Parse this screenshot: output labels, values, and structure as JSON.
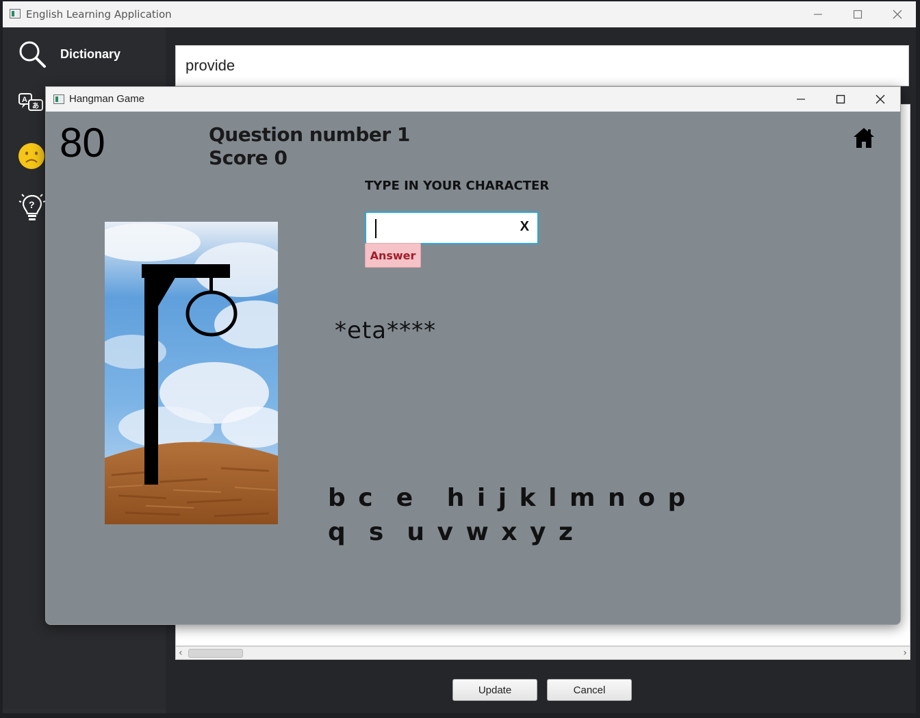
{
  "main_window": {
    "title": "English Learning Application",
    "sidebar": {
      "items": [
        {
          "label": "Dictionary",
          "icon": "search-icon"
        },
        {
          "label": "",
          "icon": "translate-icon"
        },
        {
          "label": "",
          "icon": "sad-face-icon"
        },
        {
          "label": "",
          "icon": "lightbulb-question-icon"
        }
      ]
    },
    "search": {
      "value": "provide"
    },
    "buttons": {
      "update": "Update",
      "cancel": "Cancel"
    }
  },
  "hangman": {
    "title": "Hangman Game",
    "timer": "80",
    "question": "Question number 1",
    "score": "Score 0",
    "prompt": "TYPE IN YOUR CHARACTER",
    "input_value": "",
    "clear_label": "X",
    "answer_label": "Answer",
    "masked_word": "*eta****",
    "letters_row1": "b c  e   h i j k l m n o p",
    "letters_row2": "q  s  u v w x y z",
    "home_icon": "home-icon"
  },
  "colors": {
    "dialog_bg": "#828a90",
    "answer_bg": "#f5c2c7",
    "answer_text": "#a01d2a",
    "input_border": "#2aa7d9"
  }
}
